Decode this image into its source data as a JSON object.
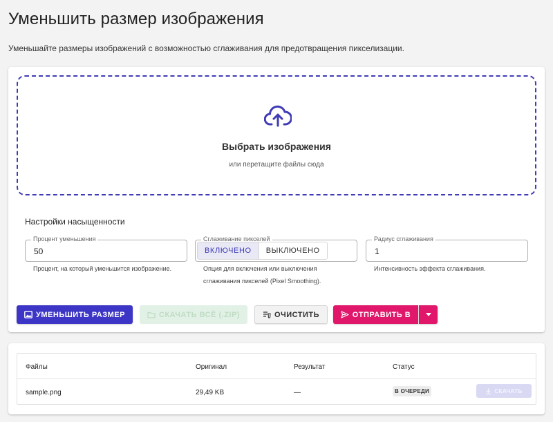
{
  "page": {
    "title": "Уменьшить размер изображения",
    "description": "Уменьшайте размеры изображений с возможностью сглаживания для предотвращения пикселизации."
  },
  "dropzone": {
    "icon": "cloud-upload-icon",
    "title": "Выбрать изображения",
    "subtitle": "или перетащите файлы сюда"
  },
  "settings": {
    "title": "Настройки насыщенности",
    "percent": {
      "label": "Процент уменьшения",
      "value": "50",
      "help": "Процент, на который уменьшится изображение."
    },
    "smoothing": {
      "label": "Сглаживание пикселей",
      "on_label": "ВКЛЮЧЕНО",
      "off_label": "ВЫКЛЮЧЕНО",
      "selected": "on",
      "help": "Опция для включения или выключения сглаживания пикселей (Pixel Smoothing)."
    },
    "radius": {
      "label": "Радиус сглаживания",
      "value": "1",
      "help": "Интенсивность эффекта сглаживания."
    }
  },
  "actions": {
    "resize_label": "УМЕНЬШИТЬ РАЗМЕР",
    "zip_label": "СКАЧАТЬ ВСЁ (.ZIP)",
    "clear_label": "ОЧИСТИТЬ",
    "send_label": "ОТПРАВИТЬ В"
  },
  "table": {
    "headers": [
      "Файлы",
      "Оригинал",
      "Результат",
      "Статус"
    ],
    "rows": [
      {
        "file": "sample.png",
        "original": "29,49 KB",
        "result": "—",
        "status": "В ОЧЕРЕДИ",
        "download_label": "СКАЧАТЬ"
      }
    ]
  },
  "colors": {
    "accent": "#3c35c5",
    "send": "#e0176a",
    "zip_disabled": "#e2f1e5"
  }
}
